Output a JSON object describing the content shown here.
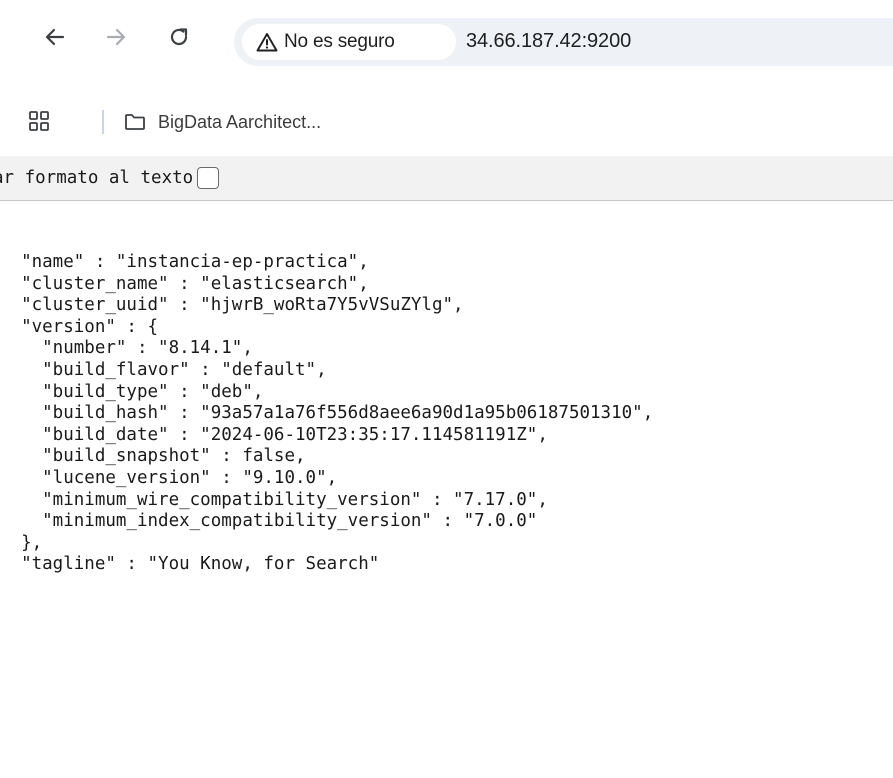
{
  "browser": {
    "security_label": "No es seguro",
    "url": "34.66.187.42:9200",
    "icons": {
      "back": "arrow-left-icon",
      "forward": "arrow-right-icon",
      "reload": "reload-icon",
      "security": "warning-triangle-icon",
      "apps": "apps-grid-icon",
      "folder": "folder-icon"
    }
  },
  "bookmarks": {
    "items": [
      {
        "label": "BigData Aarchitect..."
      }
    ]
  },
  "prettyprint": {
    "label": "ar formato al texto"
  },
  "json_lines": [
    "  \"name\" : \"instancia-ep-practica\",",
    "  \"cluster_name\" : \"elasticsearch\",",
    "  \"cluster_uuid\" : \"hjwrB_woRta7Y5vVSuZYlg\",",
    "  \"version\" : {",
    "    \"number\" : \"8.14.1\",",
    "    \"build_flavor\" : \"default\",",
    "    \"build_type\" : \"deb\",",
    "    \"build_hash\" : \"93a57a1a76f556d8aee6a90d1a95b06187501310\",",
    "    \"build_date\" : \"2024-06-10T23:35:17.114581191Z\",",
    "    \"build_snapshot\" : false,",
    "    \"lucene_version\" : \"9.10.0\",",
    "    \"minimum_wire_compatibility_version\" : \"7.17.0\",",
    "    \"minimum_index_compatibility_version\" : \"7.0.0\"",
    "  },",
    "  \"tagline\" : \"You Know, for Search\""
  ],
  "colors": {
    "omnibox_bg": "#eef1f6",
    "prettyprint_bar_bg": "#f2f2f2",
    "nav_active": "#3c4043",
    "nav_disabled": "#a8acb3"
  }
}
